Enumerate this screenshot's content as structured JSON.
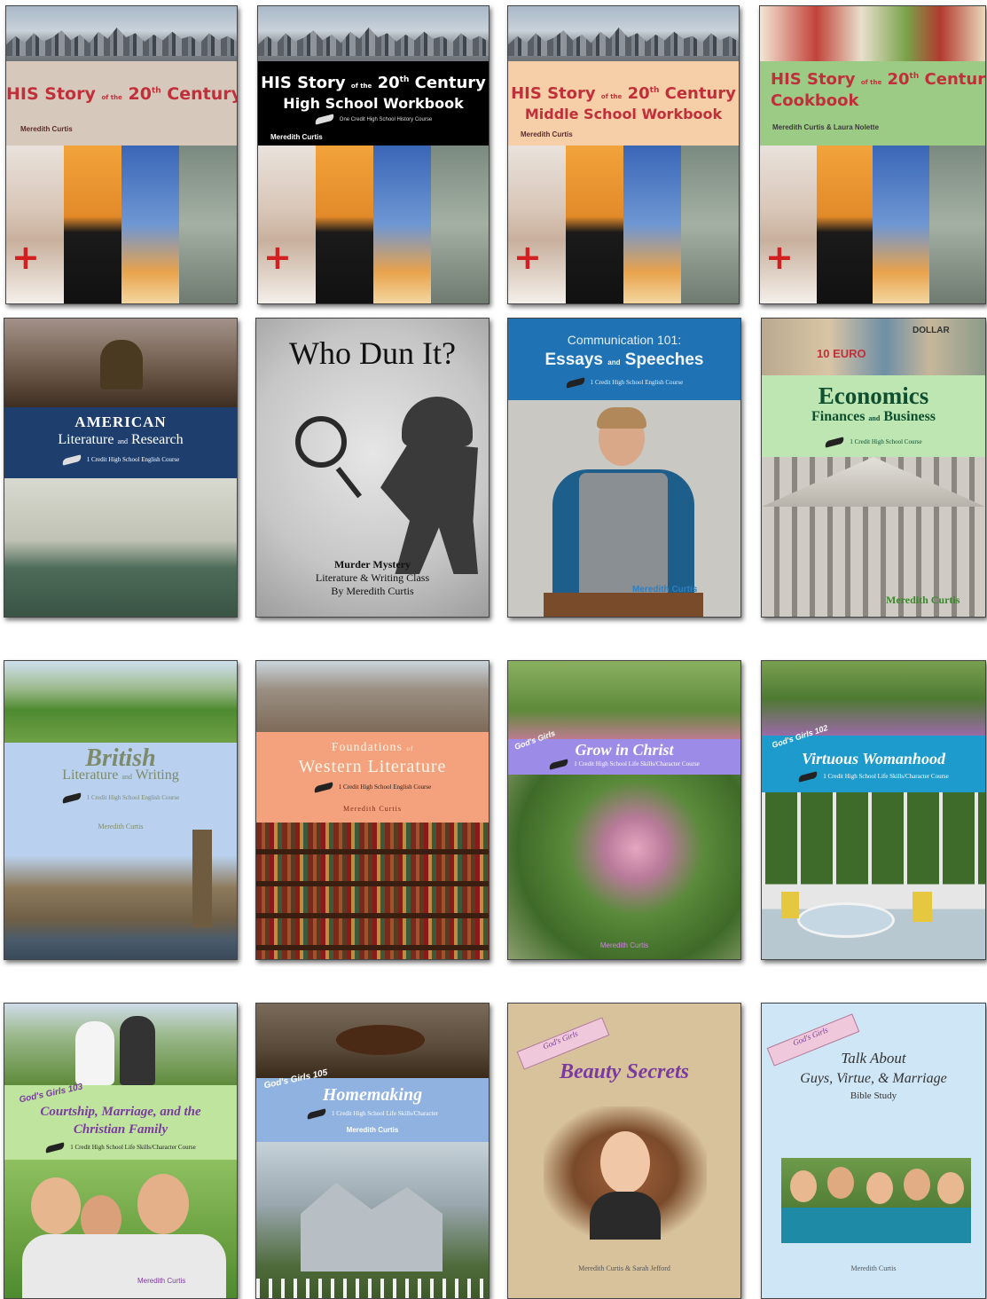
{
  "covers": {
    "his_story": {
      "title_main": "HIS Story",
      "title_of": "of the",
      "title_20": "20",
      "title_th": "th",
      "title_century": "Century",
      "author": "Meredith Curtis"
    },
    "his_story_hs": {
      "title_main": "HIS Story",
      "title_of": "of the",
      "title_20": "20",
      "title_th": "th",
      "title_century": "Century",
      "line2": "High School Workbook",
      "tagline": "One Credit High School History Course",
      "author": "Meredith Curtis"
    },
    "his_story_ms": {
      "title_main": "HIS Story",
      "title_of": "of the",
      "title_20": "20",
      "title_th": "th",
      "title_century": "Century",
      "line2": "Middle School Workbook",
      "author": "Meredith Curtis"
    },
    "his_story_cook": {
      "title_main": "HIS Story",
      "title_of": "of the",
      "title_20": "20",
      "title_th": "th",
      "title_century": "Century",
      "line2": "Cookbook",
      "author": "Meredith Curtis & Laura Nolette"
    },
    "american": {
      "line1": "AMERICAN",
      "line2a": "Literature",
      "line2b": "and",
      "line2c": "Research",
      "tagline": "1 Credit High School English Course"
    },
    "who_dun_it": {
      "title": "Who Dun It?",
      "line1": "Murder Mystery",
      "line2": "Literature & Writing Class",
      "line3": "By Meredith Curtis"
    },
    "communication": {
      "line1": "Communication 101:",
      "line2a": "Essays",
      "line2b": "and",
      "line2c": "Speeches",
      "tagline": "1 Credit High School English Course",
      "author": "Meredith Curtis"
    },
    "economics": {
      "line1": "Economics",
      "line2a": "Finances",
      "line2b": "and",
      "line2c": "Business",
      "tagline": "1 Credit High School Course",
      "author": "Meredith Curtis",
      "bill1": "10 EURO",
      "bill2": "DOLLAR"
    },
    "british": {
      "line1": "British",
      "line2a": "Literature",
      "line2b": "and",
      "line2c": "Writing",
      "tagline": "1 Credit High School English Course",
      "author": "Meredith Curtis"
    },
    "western": {
      "line1a": "Foundations",
      "line1b": "of",
      "line2": "Western Literature",
      "tagline": "1 Credit High School English Course",
      "author": "Meredith Curtis"
    },
    "grow": {
      "series": "God's Girls",
      "title": "Grow in Christ",
      "tagline": "1 Credit High School Life Skills/Character Course",
      "author": "Meredith Curtis"
    },
    "virtuous": {
      "series": "God's Girls 102",
      "title": "Virtuous Womanhood",
      "tagline": "1 Credit High School Life Skills/Character Course"
    },
    "courtship": {
      "series": "God's Girls 103",
      "line1": "Courtship, Marriage, and the",
      "line2": "Christian Family",
      "tagline": "1 Credit High School Life Skills/Character Course",
      "author": "Meredith Curtis"
    },
    "homemaking": {
      "series": "God's Girls 105",
      "title": "Homemaking",
      "tagline": "1 Credit High School Life Skills/Character",
      "author": "Meredith Curtis"
    },
    "beauty": {
      "banner": "God's Girls",
      "title": "Beauty Secrets",
      "author": "Meredith Curtis & Sarah Jefford"
    },
    "talk": {
      "banner": "God's Girls",
      "line1": "Talk About",
      "line2": "Guys, Virtue, & Marriage",
      "line3": "Bible Study",
      "author": "Meredith Curtis"
    }
  },
  "colors": {
    "his_band": "#d7c8bc",
    "his_hs_band": "#000000",
    "his_ms_band": "#f6cfa8",
    "his_cook_band": "#9ccb86",
    "american_band": "#1e3f6e",
    "comm_band": "#1f73b5",
    "econ_band": "#bde6b2",
    "british_band": "#b9d1ee",
    "western_band": "#f4a27e",
    "grow_band": "#9d8be8",
    "virtuous_band": "#1c9bcc",
    "courtship_band": "#bfe49e",
    "homemaking_band": "#8fb2e0",
    "beauty_bg": "#d8c29c",
    "talk_bg": "#cfe6f6"
  }
}
